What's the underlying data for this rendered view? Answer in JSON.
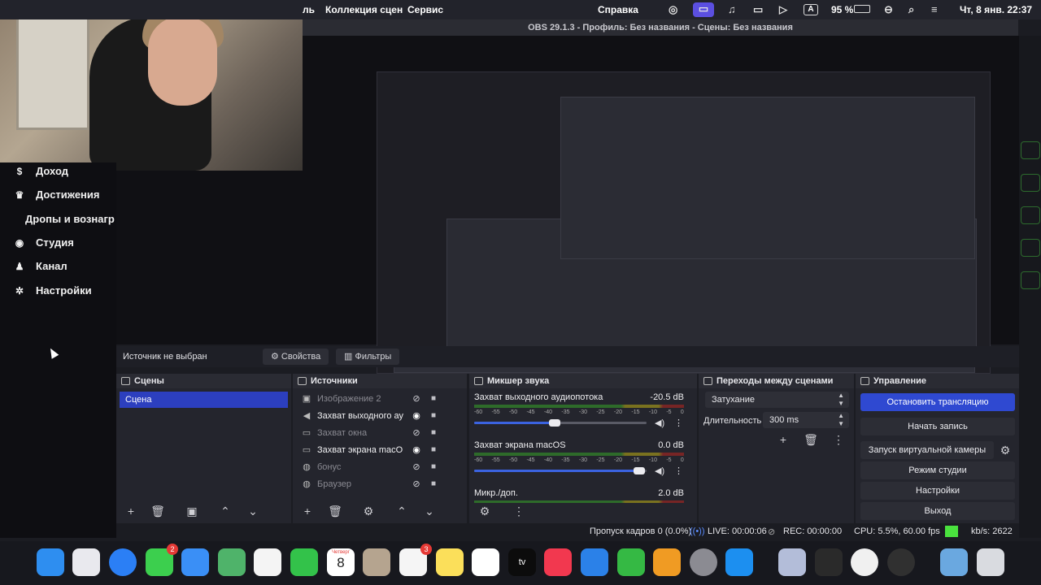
{
  "menubar": {
    "items": [
      "ль",
      "Коллекция сцен",
      "Сервис",
      "Справка"
    ],
    "battery": "95 %",
    "datetime": "Чт, 8 янв.  22:37",
    "keyboard": "A"
  },
  "obs": {
    "title": "OBS 29.1.3 - Профиль: Без названия - Сцены: Без названия"
  },
  "sidebar": {
    "items": [
      {
        "label": "Доход",
        "icon": "dollar-icon"
      },
      {
        "label": "Достижения",
        "icon": "trophy-icon"
      },
      {
        "label": "Дропы и вознагр",
        "icon": ""
      },
      {
        "label": "Студия",
        "icon": "camera-icon"
      },
      {
        "label": "Канал",
        "icon": "users-icon"
      },
      {
        "label": "Настройки",
        "icon": "gear-icon"
      }
    ]
  },
  "source_bar": {
    "no_source": "Источник не выбран",
    "properties": "Свойства",
    "filters": "Фильтры"
  },
  "scenes": {
    "title": "Сцены",
    "items": [
      "Сцена"
    ]
  },
  "sources": {
    "title": "Источники",
    "items": [
      {
        "label": "Изображение 2",
        "icon": "image-icon",
        "visible": false
      },
      {
        "label": "Захват выходного ау",
        "icon": "speaker-icon",
        "visible": true
      },
      {
        "label": "Захват окна",
        "icon": "window-icon",
        "visible": false
      },
      {
        "label": "Захват экрана macO",
        "icon": "monitor-icon",
        "visible": true
      },
      {
        "label": "бонус",
        "icon": "globe-icon",
        "visible": false
      },
      {
        "label": "Браузер",
        "icon": "globe-icon",
        "visible": false
      }
    ]
  },
  "mixer": {
    "title": "Микшер звука",
    "scale": [
      "-60",
      "-55",
      "-50",
      "-45",
      "-40",
      "-35",
      "-30",
      "-25",
      "-20",
      "-15",
      "-10",
      "-5",
      "0"
    ],
    "tracks": [
      {
        "name": "Захват выходного аудиопотока",
        "db": "-20.5 dB",
        "level": 0.48
      },
      {
        "name": "Захват экрана macOS",
        "db": "0.0 dB",
        "level": 0.97
      },
      {
        "name": "Микр./доп.",
        "db": "2.0 dB",
        "level": 1.0
      }
    ]
  },
  "transitions": {
    "title": "Переходы между сценами",
    "transition": "Затухание",
    "duration_label": "Длительность",
    "duration": "300 ms"
  },
  "controls": {
    "title": "Управление",
    "buttons": [
      "Остановить трансляцию",
      "Начать запись",
      "Запуск виртуальной камеры",
      "Режим студии",
      "Настройки",
      "Выход"
    ]
  },
  "status": {
    "dropped": "Пропуск кадров 0 (0.0%)",
    "live": "LIVE: 00:00:06",
    "rec": "REC: 00:00:00",
    "cpu": "CPU: 5.5%, 60.00 fps",
    "kbs": "kb/s: 2622",
    "kbs_color": "#4ae23e"
  },
  "dock": {
    "calendar_month": "Четверг",
    "calendar_day": "8",
    "messages_badge": "2",
    "reminders_badge": "3"
  },
  "colors": {
    "accent": "#2f49d1",
    "scene_selected": "#2c3fbf"
  }
}
